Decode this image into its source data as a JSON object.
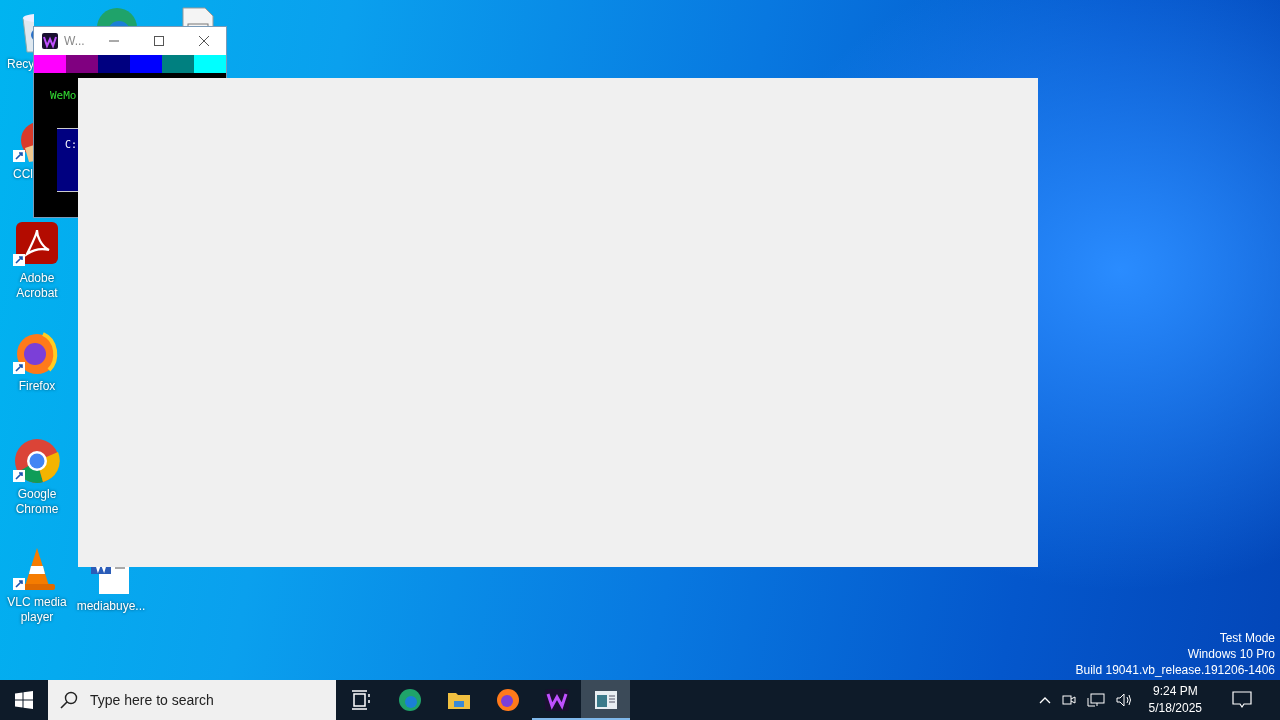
{
  "desktop": {
    "icons": [
      {
        "kind": "recycle",
        "label": "Recy"
      },
      {
        "kind": "edge"
      },
      {
        "kind": "document"
      },
      {
        "kind": "ccleaner",
        "label": "CCl"
      },
      {
        "kind": "acrobat",
        "label": "Adobe Acrobat"
      },
      {
        "kind": "firefox",
        "label": "Firefox"
      },
      {
        "kind": "chrome",
        "label": "Google Chrome"
      },
      {
        "kind": "vlc",
        "label": "VLC media player"
      },
      {
        "kind": "word",
        "label": "mediabuye..."
      }
    ]
  },
  "small_window": {
    "title": "W...",
    "palette": [
      {
        "color": "#ff00ff"
      },
      {
        "color": "#800080"
      },
      {
        "color": "#000080"
      },
      {
        "color": "#0000ff"
      },
      {
        "color": "#008080"
      },
      {
        "color": "#00ffff"
      }
    ],
    "console_text": "WeMo",
    "box_text": "C:"
  },
  "system_info": [
    "Test Mode",
    "Windows 10 Pro",
    "Build 19041.vb_release.191206-1406"
  ],
  "taskbar": {
    "search": {
      "placeholder": "Type here to search"
    },
    "apps": [
      {
        "kind": "taskview",
        "running": false,
        "selected": false
      },
      {
        "kind": "edge",
        "running": false,
        "selected": false
      },
      {
        "kind": "explorer",
        "running": false,
        "selected": false
      },
      {
        "kind": "firefox",
        "running": false,
        "selected": false
      },
      {
        "kind": "wemod",
        "running": true,
        "selected": false
      },
      {
        "kind": "window",
        "running": true,
        "selected": true
      }
    ],
    "time": "9:24 PM",
    "date": "5/18/2025"
  }
}
